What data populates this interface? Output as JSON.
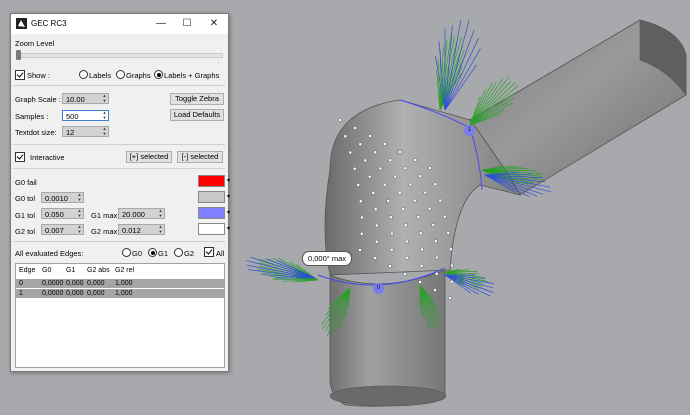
{
  "window": {
    "title": "GEC RC3",
    "minimize": "—",
    "maximize": "☐",
    "close": "✕"
  },
  "zoom": {
    "label": "Zoom Level",
    "level": 0.0
  },
  "show": {
    "label": "Show :",
    "checked": true,
    "options": [
      "Labels",
      "Graphs",
      "Labels + Graphs"
    ],
    "selected": "Labels + Graphs"
  },
  "graph": {
    "scale_label": "Graph Scale :",
    "scale_value": "10.00",
    "samples_label": "Samples :",
    "samples_value": "500",
    "textdot_label": "Textdot size:",
    "textdot_value": "12",
    "toggle_zebra": "Toggle Zebra",
    "load_defaults": "Load Defaults"
  },
  "interactive": {
    "label": "Interactive",
    "checked": true,
    "plus_selected": "[+] selected",
    "minus_selected": "[-] selected"
  },
  "tolerances": {
    "g0_fail_label": "G0 fail",
    "g0_fail_color": "#ff0000",
    "g0_tol_label": "G0 tol",
    "g0_tol_value": "0.0010",
    "g0_color": "#c8c8c8",
    "g1_tol_label": "G1 tol",
    "g1_tol_value": "0.050",
    "g1_max_label": "G1 max",
    "g1_max_value": "20.000",
    "g1_color": "#8080ff",
    "g2_tol_label": "G2 tol",
    "g2_tol_value": "0.007",
    "g2_max_label": "G2 max",
    "g2_max_value": "0.012",
    "g2_color": "#ffffff"
  },
  "edges": {
    "label": "All evaluated Edges:",
    "options": [
      "G0",
      "G1",
      "G2"
    ],
    "selected": "G1",
    "all_label": "All",
    "all_checked": true
  },
  "table": {
    "columns": [
      "Edge",
      "G0",
      "G1",
      "G2 abs",
      "G2 rel"
    ],
    "rows": [
      [
        "0",
        "0,0000",
        "0,000",
        "0,000",
        "1,000"
      ],
      [
        "1",
        "0,0000",
        "0,000",
        "0,000",
        "1,000"
      ]
    ]
  },
  "viewport": {
    "max_tag": "0,000° max",
    "point_labels": [
      "0",
      "1"
    ],
    "colors": {
      "surface": "#8f8f8f",
      "normal_g1": "#2aa02a",
      "normal_g2": "#2f4fd8",
      "background": "#a7a9ac"
    }
  }
}
